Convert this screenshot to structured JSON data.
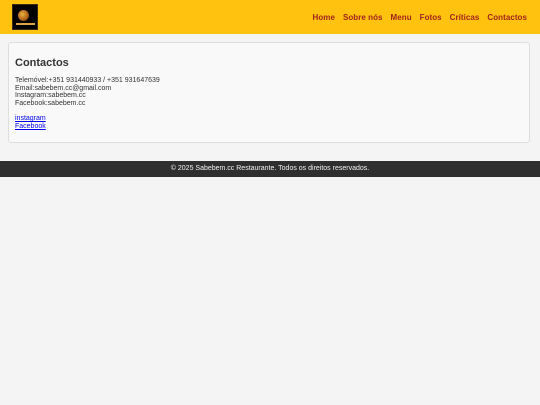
{
  "header": {
    "logo_name": "sabebem-logo",
    "nav": [
      {
        "label": "Home"
      },
      {
        "label": "Sobre nós"
      },
      {
        "label": "Menu"
      },
      {
        "label": "Fotos"
      },
      {
        "label": "Críticas"
      },
      {
        "label": "Contactos"
      }
    ]
  },
  "contact": {
    "title": "Contactos",
    "lines": [
      "Telemóvel:+351 931440933 / +351 931647639",
      "Email:sabebem.cc@gmail.com",
      "Instagram:sabebem.cc",
      "Facebook:sabebem.cc"
    ],
    "links": [
      {
        "label": "instagram"
      },
      {
        "label": "Facebook"
      }
    ]
  },
  "footer": {
    "text": "© 2025 Sabebem.cc Restaurante. Todos os direitos reservados."
  },
  "colors": {
    "header_bg": "#ffc20e",
    "nav_text": "#a3231f",
    "footer_bg": "#2f2f2f",
    "link": "#0000ee"
  }
}
